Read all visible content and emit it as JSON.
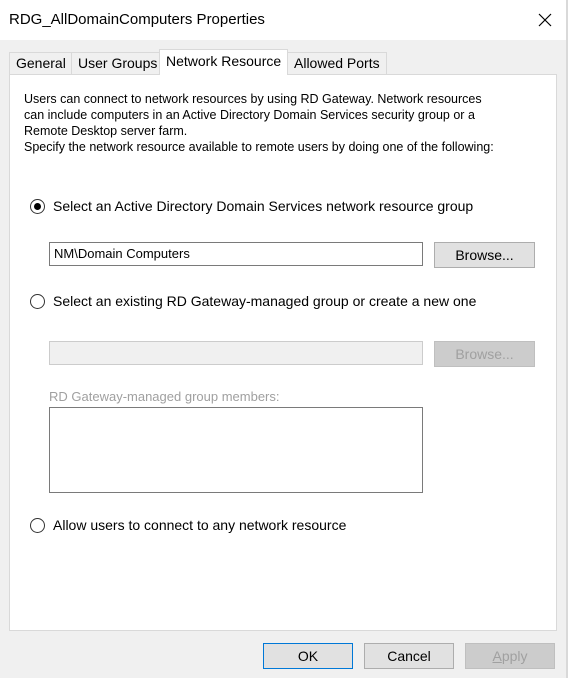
{
  "window": {
    "title": "RDG_AllDomainComputers Properties",
    "close_icon": "close-icon"
  },
  "tabs": [
    {
      "label": "General",
      "active": false
    },
    {
      "label": "User Groups",
      "active": false
    },
    {
      "label": "Network Resource",
      "active": true
    },
    {
      "label": "Allowed Ports",
      "active": false
    }
  ],
  "panel": {
    "intro_lines": [
      "Users can connect to network resources by using RD Gateway. Network resources",
      "can include computers in an Active Directory Domain Services security group or a",
      "Remote Desktop server farm.",
      "Specify the network resource available to remote users by doing one of the following:"
    ],
    "option_ad": {
      "label": "Select an Active Directory Domain Services network resource group",
      "selected": true,
      "value": "NM\\Domain Computers",
      "browse_label": "Browse..."
    },
    "option_rdg": {
      "label": "Select an existing RD Gateway-managed group or create a new one",
      "selected": false,
      "value": "",
      "browse_label": "Browse...",
      "members_label": "RD Gateway-managed group members:"
    },
    "option_any": {
      "label": "Allow users to connect to any network resource",
      "selected": false
    }
  },
  "footer": {
    "ok_label": "OK",
    "cancel_label": "Cancel",
    "apply_label": "Apply",
    "apply_mnemonic": "A",
    "apply_rest": "pply"
  }
}
